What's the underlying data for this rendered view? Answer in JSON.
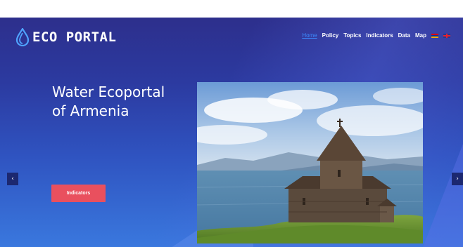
{
  "header": {
    "logo_text": "ECO PORTAL",
    "logo_icon": "water-drop-icon"
  },
  "nav": {
    "items": [
      {
        "label": "Home",
        "active": true
      },
      {
        "label": "Policy",
        "active": false
      },
      {
        "label": "Topics",
        "active": false
      },
      {
        "label": "Indicators",
        "active": false
      },
      {
        "label": "Data",
        "active": false
      },
      {
        "label": "Map",
        "active": false
      }
    ],
    "languages": [
      "flag-armenia-icon",
      "flag-uk-icon"
    ]
  },
  "hero": {
    "title_line1": "Water Ecoportal",
    "title_line2": "of Armenia",
    "cta_label": "Indicators",
    "prev_icon": "chevron-left-icon",
    "next_icon": "chevron-right-icon",
    "image": "lake-sevan-church-photo"
  },
  "colors": {
    "accent": "#e9505e",
    "nav_active": "#3d8bff",
    "hero_top": "#2d2f8c",
    "hero_bottom": "#3a78de"
  }
}
